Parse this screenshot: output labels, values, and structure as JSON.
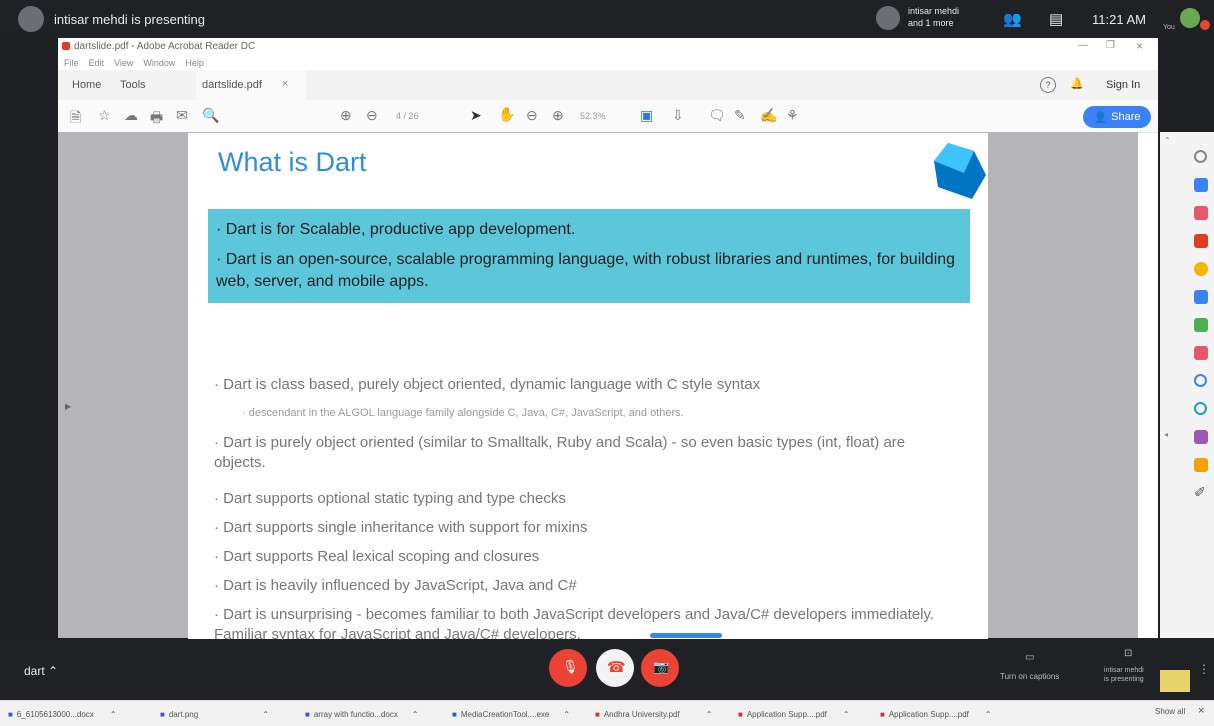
{
  "meeting": {
    "presenter_banner": "intisar mehdi is presenting",
    "participant_name": "intisar mehdi",
    "participant_more": "and 1 more",
    "time": "11:21 AM",
    "you_label": "You",
    "meeting_name": "dart",
    "captions_label": "Turn on captions",
    "presenting_label_1": "intisar mehdi",
    "presenting_label_2": "is presenting"
  },
  "acrobat": {
    "window_title": "dartslide.pdf - Adobe Acrobat Reader DC",
    "menu": [
      "File",
      "Edit",
      "View",
      "Window",
      "Help"
    ],
    "tabs": [
      "Home",
      "Tools"
    ],
    "doc_tab": "dartslide.pdf",
    "sign_in": "Sign In",
    "share": "Share",
    "page_indicator": "4 / 26",
    "zoom": "52.3%"
  },
  "slide": {
    "title": "What is Dart",
    "highlight_bullets": [
      "Dart is for Scalable, productive app development.",
      "Dart is an open-source, scalable programming language, with robust libraries and runtimes, for building web, server, and mobile apps."
    ],
    "bullets": [
      "Dart is class based, purely object oriented, dynamic language with C style syntax",
      "descendant in the ALGOL language family alongside C, Java, C#, JavaScript, and others.",
      "Dart is purely object oriented (similar to Smalltalk, Ruby and Scala) - so even basic types (int, float) are objects.",
      "Dart supports optional static typing and type checks",
      "Dart supports single inheritance with support for mixins",
      "Dart supports Real lexical scoping and closures",
      "Dart is heavily influenced by JavaScript, Java and C#",
      "Dart is unsurprising - becomes familiar to both JavaScript developers and Java/C# developers immediately. Familiar syntax for JavaScript and Java/C# developers."
    ]
  },
  "downloads": {
    "items": [
      "6_6105613000...docx",
      "dart.png",
      "array with functio...docx",
      "MediaCreationTool....exe",
      "Andhra University.pdf",
      "Application Supp....pdf",
      "Application Supp....pdf"
    ],
    "show_all": "Show all"
  },
  "colors": {
    "accent_blue": "#2e8fd8",
    "teal_box": "#5cc6da",
    "call_red": "#ea4335"
  }
}
